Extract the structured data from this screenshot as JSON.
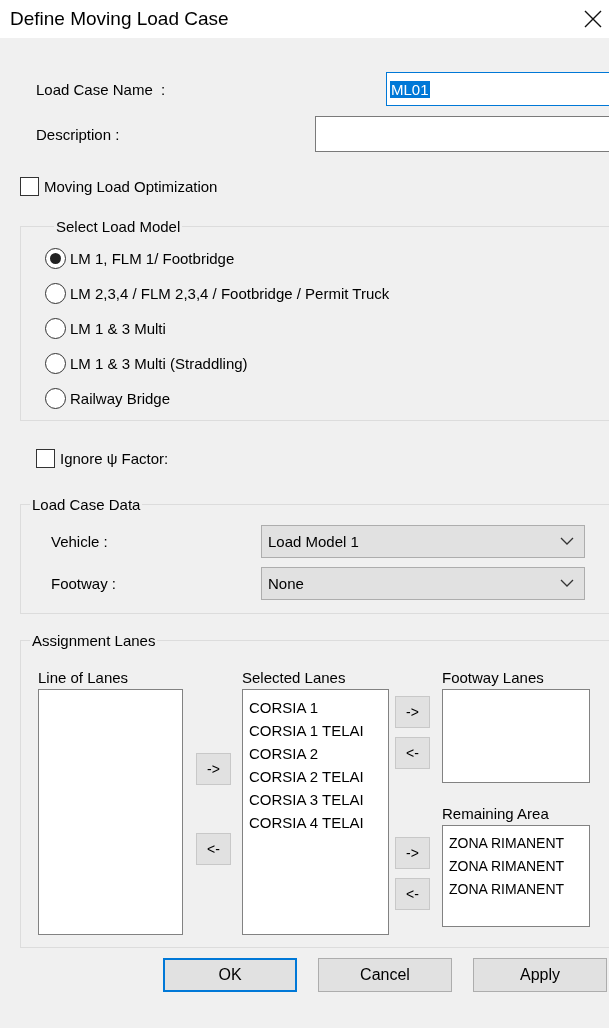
{
  "window": {
    "title": "Define Moving Load Case"
  },
  "fields": [
    {
      "label": "Load Case Name  :",
      "value": "ML01",
      "focused": true
    },
    {
      "label": "Description :",
      "focused": false
    }
  ],
  "optimization": {
    "label": "Moving Load Optimization",
    "checked": false
  },
  "load_model": {
    "title": "Select Load Model",
    "options": [
      {
        "label": "LM 1, FLM 1/ Footbridge",
        "selected": true
      },
      {
        "label": "LM 2,3,4 / FLM 2,3,4 / Footbridge / Permit Truck",
        "selected": false
      },
      {
        "label": "LM 1 & 3 Multi",
        "selected": false
      },
      {
        "label": "LM 1 & 3 Multi (Straddling)",
        "selected": false
      },
      {
        "label": "Railway Bridge",
        "selected": false
      }
    ]
  },
  "ignore_factor": {
    "label": "Ignore ψ Factor:",
    "checked": false
  },
  "load_case_data": {
    "title": "Load Case Data",
    "rows": [
      {
        "label": "Vehicle :",
        "value": "Load Model 1"
      },
      {
        "label": "Footway :",
        "value": "None"
      }
    ]
  },
  "assignment": {
    "title": "Assignment Lanes",
    "line_of_lanes": {
      "label": "Line of Lanes"
    },
    "left_buttons": [
      "->",
      "<-"
    ],
    "selected_lanes": {
      "label": "Selected Lanes",
      "items": [
        "CORSIA 1",
        "CORSIA 1 TELAI",
        "CORSIA 2",
        "CORSIA 2 TELAI",
        "CORSIA 3 TELAI",
        "CORSIA 4 TELAI"
      ]
    },
    "footway_buttons": [
      "->",
      "<-"
    ],
    "footway_lanes": {
      "label": "Footway Lanes"
    },
    "remaining_buttons": [
      "->",
      "<-"
    ],
    "remaining_area": {
      "label": "Remaining Area",
      "items": [
        "ZONA RIMANENT",
        "ZONA RIMANENT",
        "ZONA RIMANENT"
      ]
    }
  },
  "buttons": [
    {
      "label": "OK",
      "default": true
    },
    {
      "label": "Cancel",
      "default": false
    },
    {
      "label": "Apply",
      "default": false
    }
  ]
}
